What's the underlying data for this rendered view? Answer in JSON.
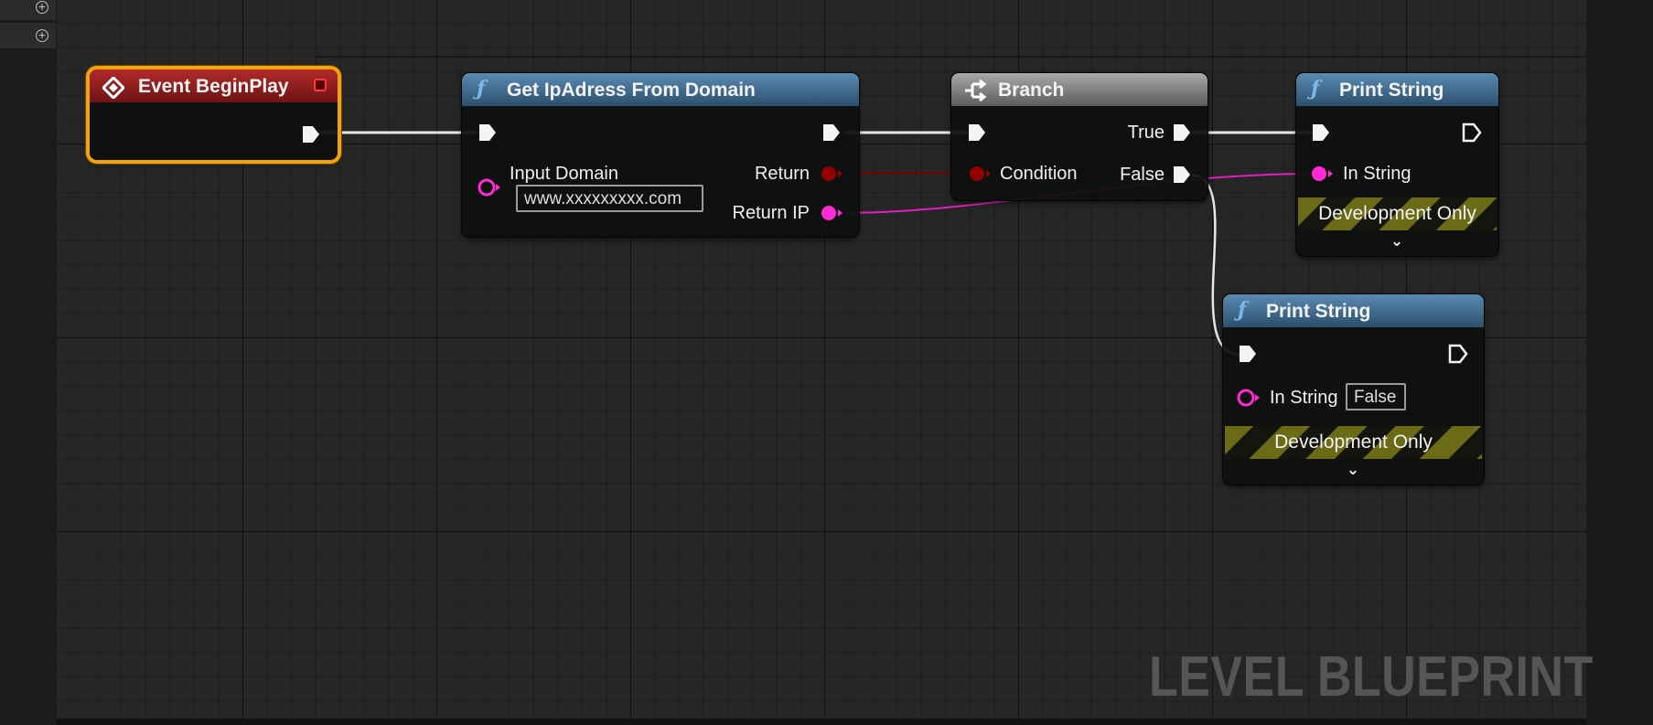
{
  "sidebar": {
    "rows": [
      {
        "add_icon": "plus-circle-icon"
      },
      {
        "add_icon": "plus-circle-icon"
      }
    ]
  },
  "nodes": {
    "event_begin_play": {
      "title": "Event BeginPlay",
      "icon": "event-diamond-icon",
      "header_color": "#8e1e1e",
      "selected": true,
      "selection_color": "#f2a20a"
    },
    "get_ip": {
      "title": "Get IpAdress From Domain",
      "icon": "function-icon",
      "input_label": "Input Domain",
      "input_value": "www.xxxxxxxxx.com",
      "output_return": "Return",
      "output_return_ip": "Return IP"
    },
    "branch": {
      "title": "Branch",
      "icon": "branch-icon",
      "condition_label": "Condition",
      "true_label": "True",
      "false_label": "False"
    },
    "print_string_1": {
      "title": "Print String",
      "icon": "function-icon",
      "in_string_label": "In String",
      "dev_only": "Development Only",
      "expand_icon": "chevron-down-icon"
    },
    "print_string_2": {
      "title": "Print String",
      "icon": "function-icon",
      "in_string_label": "In String",
      "in_string_value": "False",
      "dev_only": "Development Only",
      "expand_icon": "chevron-down-icon"
    }
  },
  "watermark": "LEVEL BLUEPRINT",
  "colors": {
    "function_header": "#3f6a8e",
    "branch_header": "#8a8a8a",
    "string_pin": "#ff2ad4",
    "bool_pin": "#940000",
    "exec_wire": "#e6e6e6"
  }
}
